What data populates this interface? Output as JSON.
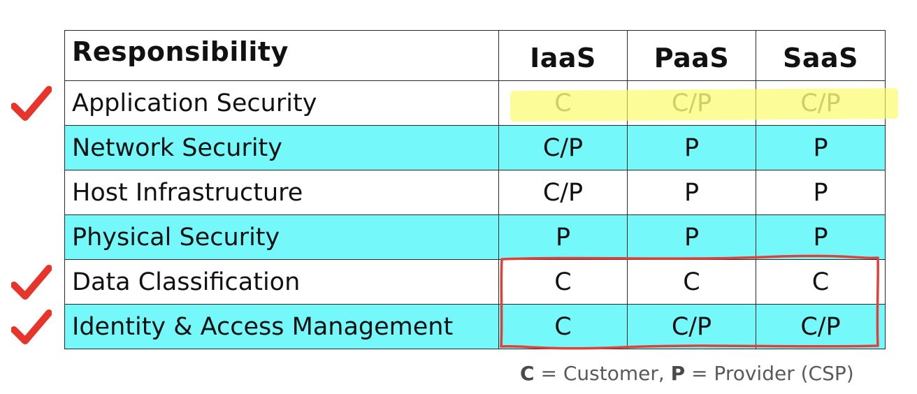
{
  "table": {
    "headers": {
      "responsibility": "Responsibility",
      "iaas": "IaaS",
      "paas": "PaaS",
      "saas": "SaaS"
    },
    "rows": [
      {
        "name": "Application Security",
        "iaas": "C",
        "paas": "C/P",
        "saas": "C/P",
        "checked": true,
        "highlighted": true,
        "row_color": "#ffffff"
      },
      {
        "name": "Network Security",
        "iaas": "C/P",
        "paas": "P",
        "saas": "P",
        "checked": false,
        "highlighted": false,
        "row_color": "#75f8fa"
      },
      {
        "name": "Host Infrastructure",
        "iaas": "C/P",
        "paas": "P",
        "saas": "P",
        "checked": false,
        "highlighted": false,
        "row_color": "#ffffff"
      },
      {
        "name": "Physical Security",
        "iaas": "P",
        "paas": "P",
        "saas": "P",
        "checked": false,
        "highlighted": false,
        "row_color": "#75f8fa"
      },
      {
        "name": "Data Classification",
        "iaas": "C",
        "paas": "C",
        "saas": "C",
        "checked": true,
        "highlighted": false,
        "row_color": "#ffffff"
      },
      {
        "name": "Identity & Access Management",
        "iaas": "C",
        "paas": "C/P",
        "saas": "C/P",
        "checked": true,
        "highlighted": false,
        "row_color": "#75f8fa"
      }
    ]
  },
  "legend": {
    "c_key": "C",
    "c_text": " = Customer, ",
    "p_key": "P",
    "p_text": " = Provider (CSP)"
  },
  "annotations": {
    "check_icon": "red-check-mark-icon",
    "check_color": "#e8352b",
    "highlight_color": "#fafa5a",
    "box_color": "#e0403a"
  }
}
